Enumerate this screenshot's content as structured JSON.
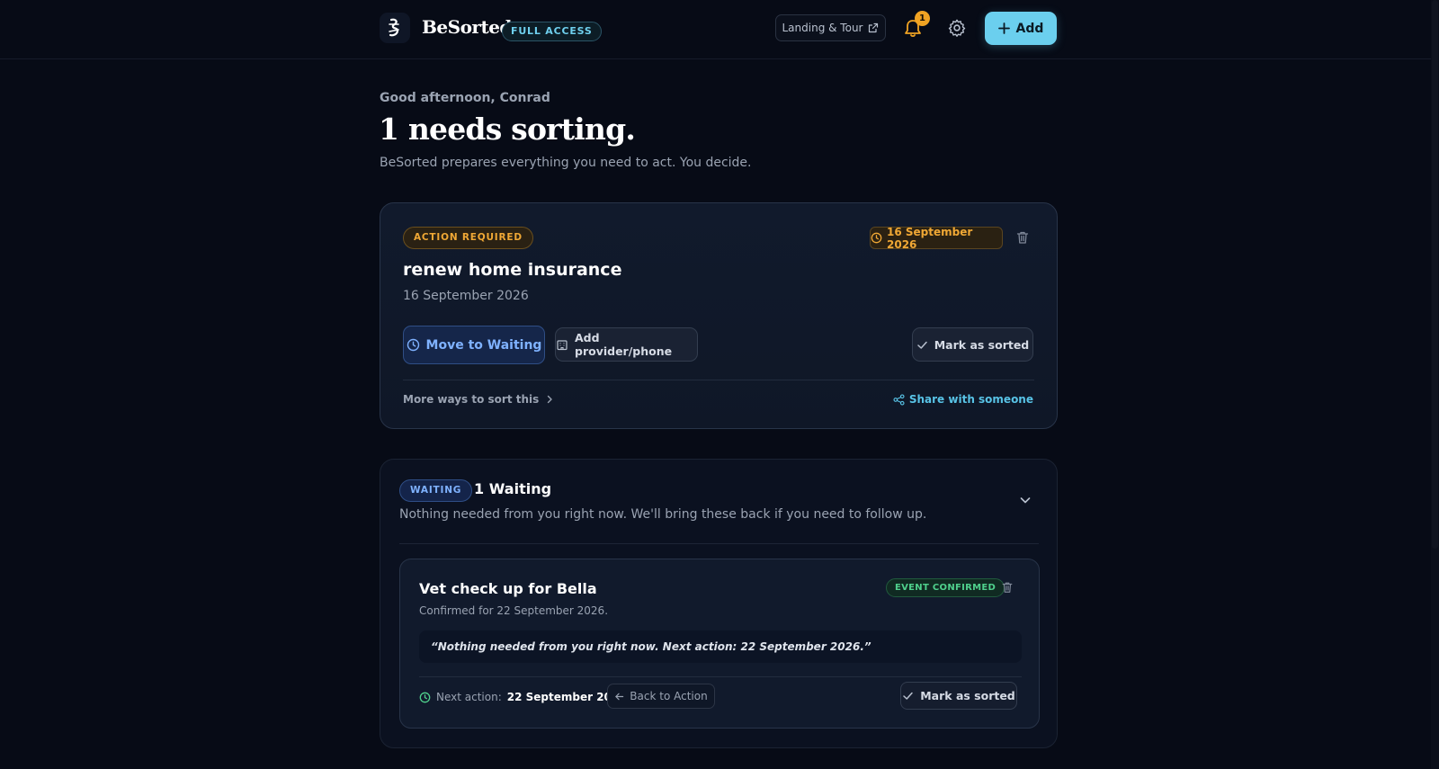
{
  "header": {
    "brand": "BeSorted",
    "access_badge": "FULL ACCESS",
    "landing_label": "Landing & Tour",
    "notification_count": "1",
    "add_label": "Add"
  },
  "intro": {
    "greeting": "Good afternoon, Conrad",
    "headline": "1 needs sorting.",
    "subline": "BeSorted prepares everything you need to act. You decide."
  },
  "action_card": {
    "status": "ACTION REQUIRED",
    "due_chip": "16 September 2026",
    "title": "renew home insurance",
    "date": "16 September 2026",
    "move_waiting_label": "Move to Waiting",
    "add_provider_label": "Add provider/phone",
    "mark_sorted_label": "Mark as sorted",
    "more_ways_label": "More ways to sort this",
    "share_label": "Share with someone"
  },
  "waiting_section": {
    "pill": "WAITING",
    "title": "1 Waiting",
    "description": "Nothing needed from you right now. We'll bring these back if you need to follow up.",
    "item": {
      "title": "Vet check up for Bella",
      "confirmed": "Confirmed for 22 September 2026.",
      "status": "EVENT CONFIRMED",
      "quote": "“Nothing needed from you right now. Next action: 22 September 2026.”",
      "next_action_label": "Next action:",
      "next_action_date": "22 September 2026",
      "back_label": "Back to Action",
      "mark_sorted_label": "Mark as sorted"
    }
  },
  "colors": {
    "background": "#070b16",
    "accent": "#6bcfee",
    "warning": "#f0a835",
    "waiting": "#7fb2ff",
    "success": "#4fd08c"
  },
  "icons": [
    "logo-icon",
    "external-link-icon",
    "bell-icon",
    "gear-icon",
    "plus-icon",
    "clock-icon",
    "trash-icon",
    "building-icon",
    "check-icon",
    "chevron-right-icon",
    "share-icon",
    "chevron-down-icon",
    "arrow-left-icon"
  ]
}
